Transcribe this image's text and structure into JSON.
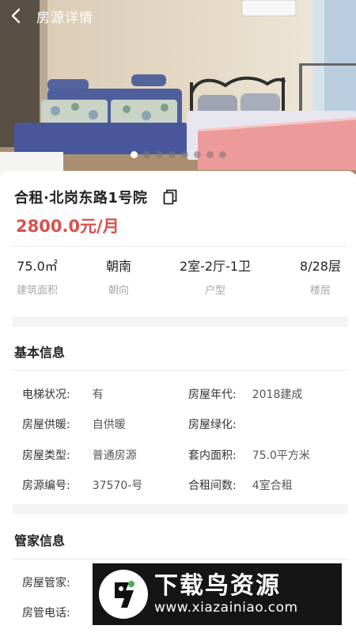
{
  "header": {
    "title": "房源详情"
  },
  "carousel": {
    "total": 8,
    "active": 0
  },
  "listing": {
    "title": "合租·北岗东路1号院",
    "price": "2800.0元/月",
    "stats": [
      {
        "value": "75.0㎡",
        "label": "建筑面积"
      },
      {
        "value": "朝南",
        "label": "朝向"
      },
      {
        "value": "2室-2厅-1卫",
        "label": "户型"
      },
      {
        "value": "8/28层",
        "label": "楼层"
      }
    ]
  },
  "basic_info": {
    "title": "基本信息",
    "rows": [
      [
        {
          "key": "电梯状况:",
          "value": "有"
        },
        {
          "key": "房屋年代:",
          "value": "2018建成"
        }
      ],
      [
        {
          "key": "房屋供暖:",
          "value": "自供暖"
        },
        {
          "key": "房屋绿化:",
          "value": ""
        }
      ],
      [
        {
          "key": "房屋类型:",
          "value": "普通房源"
        },
        {
          "key": "套内面积:",
          "value": "75.0平方米"
        }
      ],
      [
        {
          "key": "房源编号:",
          "value": "37570-号"
        },
        {
          "key": "合租间数:",
          "value": "4室合租"
        }
      ]
    ]
  },
  "manager_info": {
    "title": "管家信息",
    "rows": [
      {
        "key": "房屋管家:"
      },
      {
        "key": "房管电话:"
      }
    ]
  },
  "watermark": {
    "brand": "下载鸟资源",
    "url": "www.xiazainiao.com"
  },
  "colors": {
    "price": "#d9514d",
    "sofa": "#4f5f9c",
    "bedding": "#ec9a9a"
  }
}
